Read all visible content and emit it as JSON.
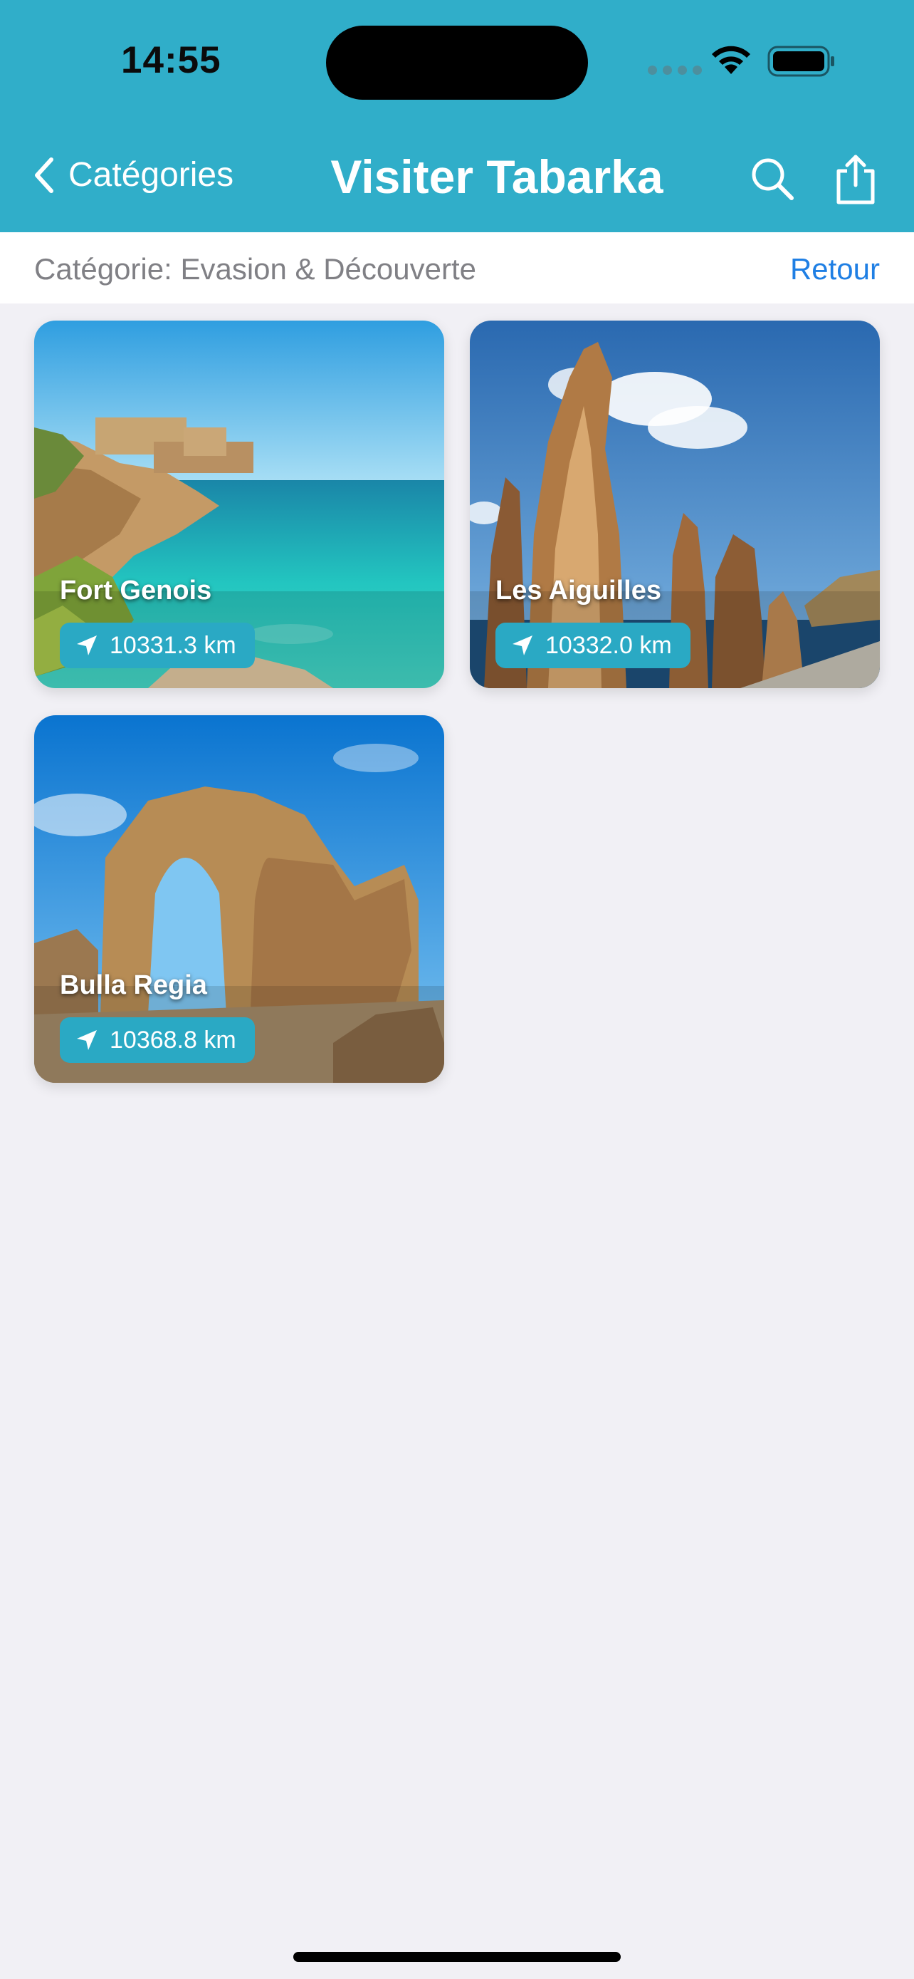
{
  "status_bar": {
    "time": "14:55"
  },
  "nav": {
    "back_label": "Catégories",
    "title": "Visiter Tabarka"
  },
  "category_bar": {
    "label": "Catégorie: Evasion & Découverte",
    "retour": "Retour"
  },
  "places": [
    {
      "name": "Fort Genois",
      "distance": "10331.3 km"
    },
    {
      "name": "Les Aiguilles",
      "distance": "10332.0 km"
    },
    {
      "name": "Bulla Regia",
      "distance": "10368.8 km"
    }
  ],
  "colors": {
    "header": "#30aec9",
    "badge": "#2aa9c4",
    "link": "#1f7fe4",
    "background": "#f1f0f5"
  }
}
